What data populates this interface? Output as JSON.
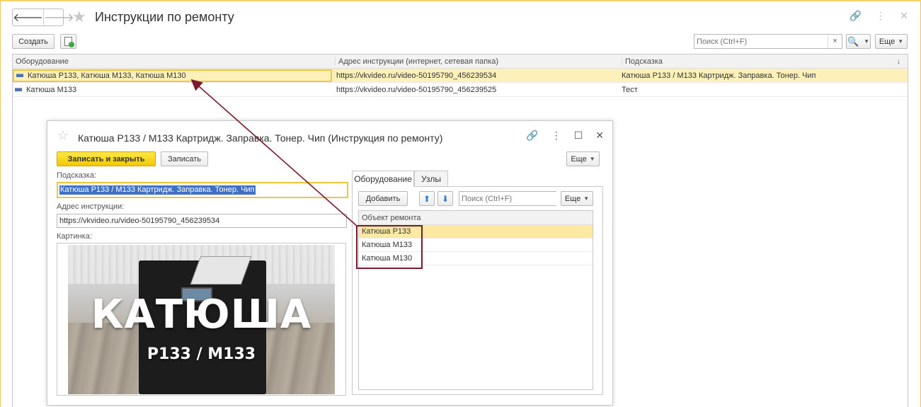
{
  "window": {
    "title": "Инструкции по ремонту",
    "nav_back": "🡐",
    "nav_forward": "🡒"
  },
  "toolbar": {
    "create_label": "Создать",
    "search_placeholder": "Поиск (Ctrl+F)",
    "search_clear": "×",
    "more_label": "Еще"
  },
  "list": {
    "columns": [
      "Оборудование",
      "Адрес инструкции (интернет, сетевая папка)",
      "Подсказка"
    ],
    "sort_indicator": "↓",
    "rows": [
      {
        "equipment": "Катюша P133, Катюша M133, Катюша M130",
        "address": "https://vkvideo.ru/video-50195790_456239534",
        "hint": "Катюша P133 / M133 Картридж. Заправка. Тонер. Чип",
        "selected": true
      },
      {
        "equipment": "Катюша M133",
        "address": "https://vkvideo.ru/video-50195790_456239525",
        "hint": "Тест",
        "selected": false
      }
    ]
  },
  "dialog": {
    "title": "Катюша P133 / M133 Картридж. Заправка. Тонер. Чип (Инструкция по ремонту)",
    "save_close_label": "Записать и закрыть",
    "save_label": "Записать",
    "more_label": "Еще",
    "hint_label": "Подсказка:",
    "hint_value": "Катюша P133 / M133 Картридж. Заправка. Тонер. Чип",
    "address_label": "Адрес инструкции:",
    "address_value": "https://vkvideo.ru/video-50195790_456239534",
    "picture_label": "Картинка:",
    "picture_big_text": "КАТЮША",
    "picture_small_text": "P133 / M133",
    "tabs": [
      "Оборудование",
      "Узлы"
    ],
    "panel": {
      "add_label": "Добавить",
      "search_placeholder": "Поиск (Ctrl+F)",
      "search_clear": "×",
      "more_label": "Еще",
      "column": "Объект ремонта",
      "rows": [
        "Катюша P133",
        "Катюша M133",
        "Катюша M130"
      ]
    }
  },
  "colors": {
    "selection": "#fdf0b8",
    "focus_border": "#f0c63c",
    "primary_button": "#f5d20a",
    "annotation": "#7a1a2b"
  }
}
